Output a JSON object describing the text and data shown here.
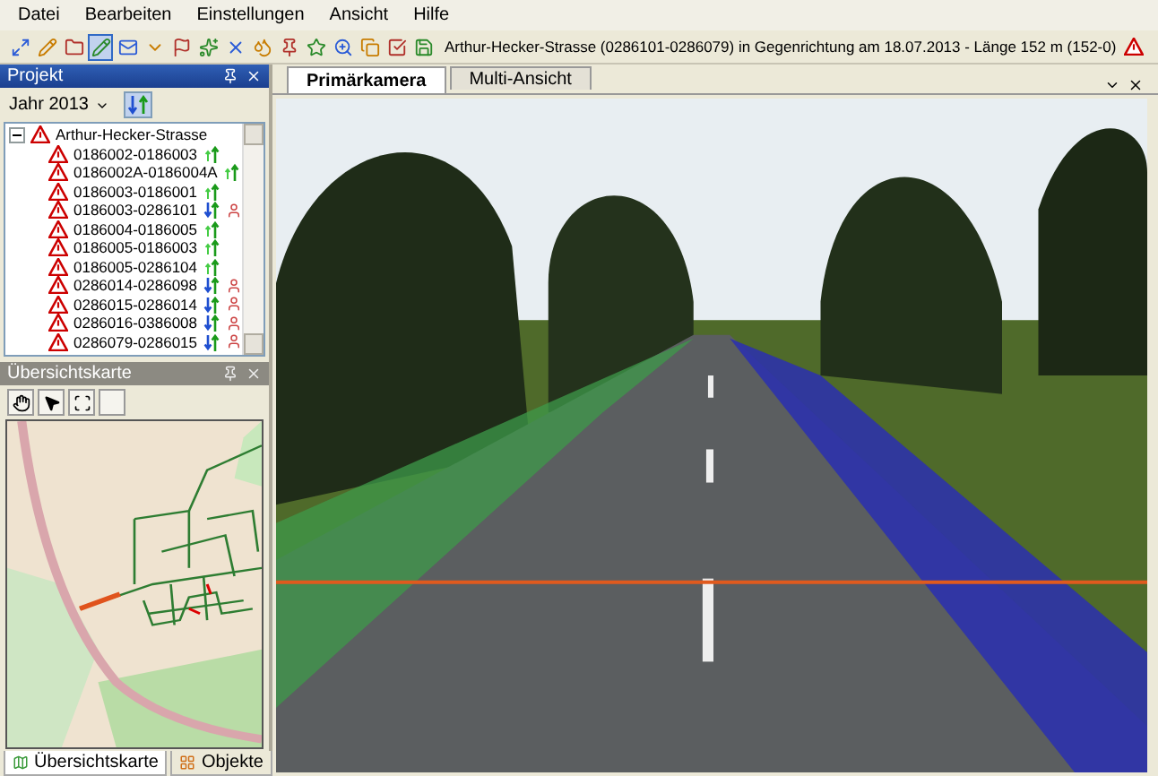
{
  "menu": [
    "Datei",
    "Bearbeiten",
    "Einstellungen",
    "Ansicht",
    "Hilfe"
  ],
  "toolbar": {
    "title": "Arthur-Hecker-Strasse (0286101-0286079) in Gegenrichtung am 18.07.2013 - Länge 152 m (152-0)"
  },
  "project_panel": {
    "title": "Projekt",
    "year": "Jahr 2013",
    "tree": {
      "label": "Arthur-Hecker-Strasse",
      "expanded": true,
      "children": [
        {
          "label": "0186002-0186003",
          "kind": "up",
          "marker": false
        },
        {
          "label": "0186002A-0186004A",
          "kind": "up",
          "marker": false
        },
        {
          "label": "0186003-0186001",
          "kind": "up",
          "marker": false
        },
        {
          "label": "0186003-0286101",
          "kind": "both",
          "marker": true
        },
        {
          "label": "0186004-0186005",
          "kind": "up",
          "marker": false
        },
        {
          "label": "0186005-0186003",
          "kind": "up",
          "marker": false
        },
        {
          "label": "0186005-0286104",
          "kind": "up",
          "marker": false
        },
        {
          "label": "0286014-0286098",
          "kind": "both",
          "marker": true
        },
        {
          "label": "0286015-0286014",
          "kind": "both",
          "marker": true
        },
        {
          "label": "0286016-0386008",
          "kind": "both",
          "marker": true
        },
        {
          "label": "0286079-0286015",
          "kind": "both",
          "marker": true
        }
      ]
    }
  },
  "overview_panel": {
    "title": "Übersichtskarte"
  },
  "bottom_tabs": [
    {
      "label": "Übersichtskarte",
      "selected": true
    },
    {
      "label": "Objekte",
      "selected": false
    }
  ],
  "view_tabs": [
    {
      "label": "Primärkamera",
      "selected": true
    },
    {
      "label": "Multi-Ansicht",
      "selected": false
    }
  ]
}
